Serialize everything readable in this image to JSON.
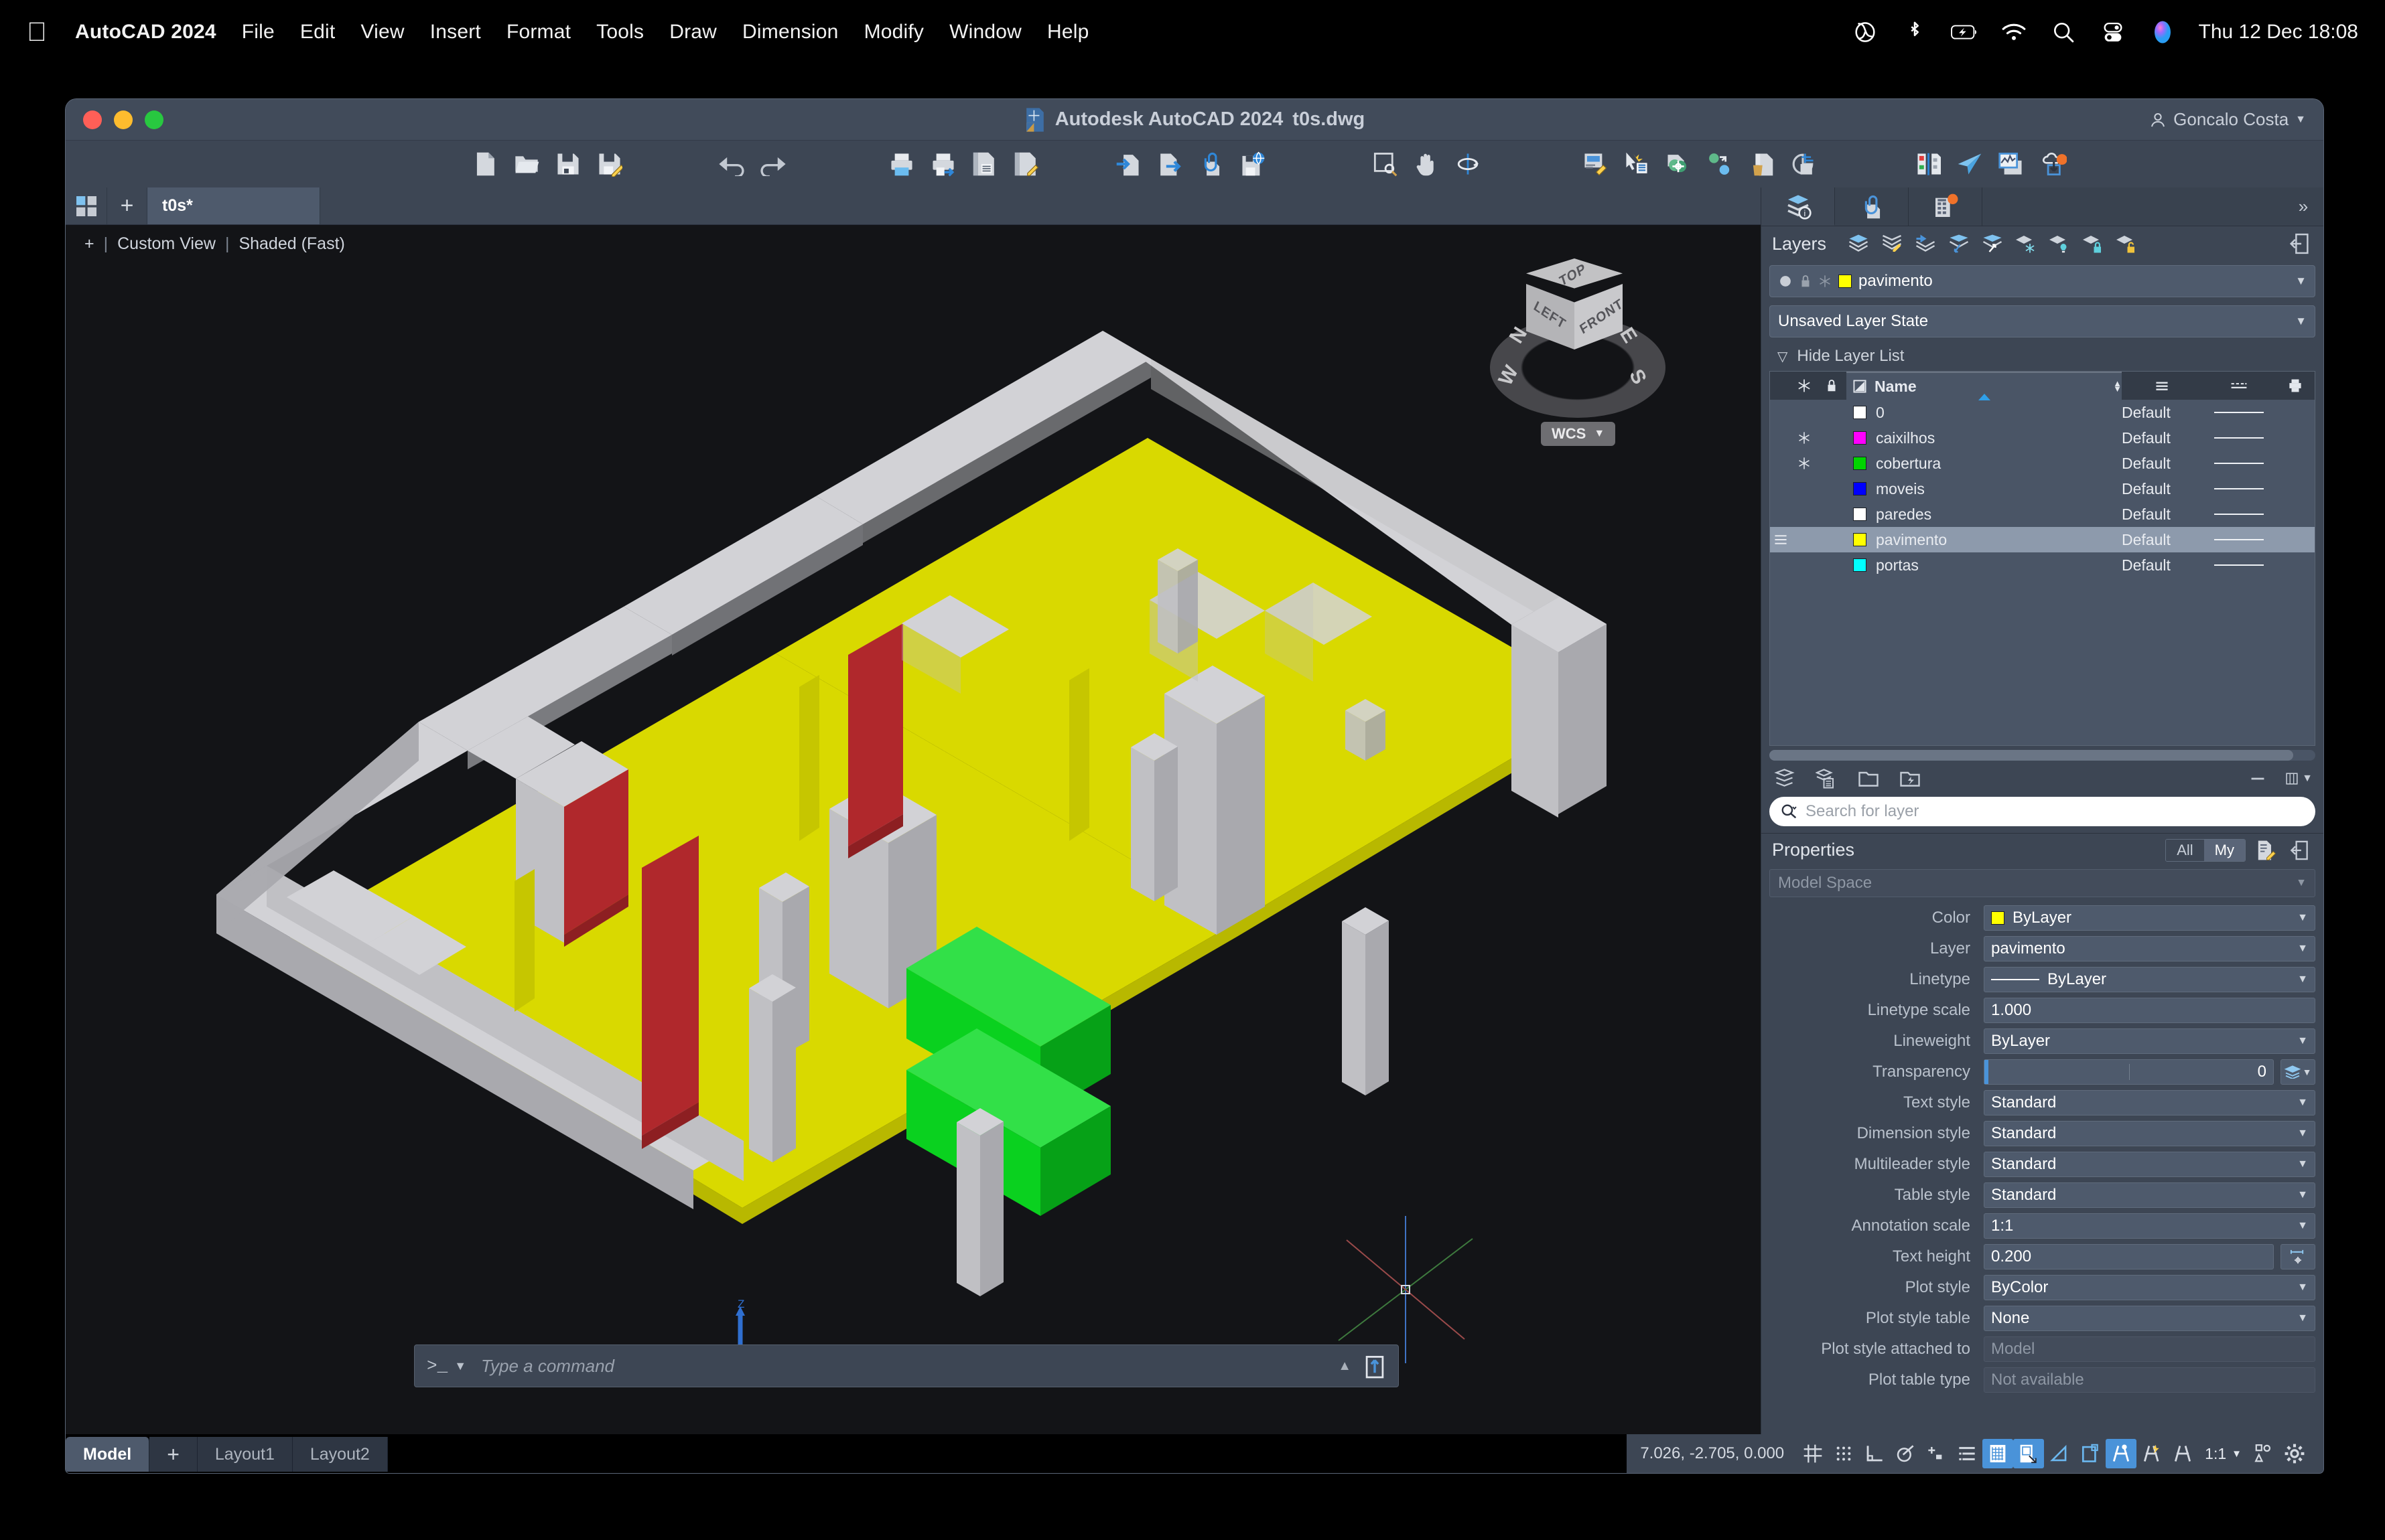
{
  "macos_menubar": {
    "apple_icon": "apple-logo-icon",
    "app_name": "AutoCAD 2024",
    "menus": [
      "File",
      "Edit",
      "View",
      "Insert",
      "Format",
      "Tools",
      "Draw",
      "Dimension",
      "Modify",
      "Window",
      "Help"
    ],
    "status_icons": [
      "creative-cloud-icon",
      "bluetooth-icon",
      "battery-charging-icon",
      "wifi-icon",
      "spotlight-search-icon",
      "control-center-icon",
      "siri-icon"
    ],
    "clock": "Thu 12 Dec  18:08"
  },
  "window": {
    "title": "Autodesk AutoCAD 2024",
    "document": "t0s.dwg",
    "user": "Goncalo Costa",
    "traffic_lights": [
      "close",
      "minimize",
      "zoom"
    ]
  },
  "toolbar": {
    "groups": [
      {
        "name": "file",
        "items": [
          "new-drawing-icon",
          "open-drawing-icon",
          "save-icon",
          "save-as-icon"
        ]
      },
      {
        "name": "history",
        "items": [
          "undo-icon",
          "redo-icon"
        ]
      },
      {
        "name": "plot",
        "items": [
          "plot-icon",
          "plot-preview-icon",
          "page-setup-icon",
          "batch-plot-icon"
        ]
      },
      {
        "name": "exchange",
        "items": [
          "import-icon",
          "export-icon",
          "attach-icon",
          "etransmit-icon"
        ]
      },
      {
        "name": "view",
        "items": [
          "zoom-window-icon",
          "pan-icon",
          "orbit-icon"
        ]
      },
      {
        "name": "tools",
        "items": [
          "properties-icon",
          "quick-select-icon",
          "match-properties-icon",
          "layer-state-icon",
          "purge-icon",
          "measure-icon"
        ]
      },
      {
        "name": "collab",
        "items": [
          "compare-drawings-icon",
          "share-icon",
          "sheet-set-icon",
          "cloud-sync-icon"
        ]
      }
    ]
  },
  "document_tabs": {
    "grid_icon": "drawing-grid-icon",
    "new_tab_icon": "plus-icon",
    "tabs": [
      {
        "label": "t0s*",
        "active": true
      }
    ]
  },
  "viewport": {
    "plus_icon": "viewport-controls-icon",
    "view_label": "Custom View",
    "visual_style": "Shaded (Fast)",
    "viewcube": {
      "top_face": "TOP",
      "left_face": "LEFT",
      "front_face": "FRONT",
      "compass": [
        "N",
        "E",
        "S",
        "W"
      ],
      "coord_system_label": "WCS"
    },
    "ucs_axes": [
      "X",
      "Y",
      "Z"
    ],
    "model_description": "3D shaded apartment floor plan model with grey walls, yellow floor slab, red door panels, green furniture blocks and grey columns"
  },
  "command_line": {
    "prompt": ">_",
    "placeholder": "Type a command",
    "history_icon": "chevron-up-icon",
    "dock_icon": "command-dock-icon"
  },
  "layout_tabs": {
    "tabs": [
      {
        "label": "Model",
        "active": true
      },
      {
        "label": "+",
        "active": false,
        "is_add": true
      },
      {
        "label": "Layout1",
        "active": false
      },
      {
        "label": "Layout2",
        "active": false
      }
    ]
  },
  "status_bar": {
    "coordinates": "7.026,  -2.705, 0.000",
    "icons": [
      {
        "name": "grid-display-icon",
        "on": false
      },
      {
        "name": "snap-mode-icon",
        "on": false
      },
      {
        "name": "ortho-mode-icon",
        "on": false
      },
      {
        "name": "polar-tracking-icon",
        "on": false
      },
      {
        "name": "object-snap-tracking-icon",
        "on": false
      },
      {
        "name": "dynamic-ucs-icon",
        "on": false
      },
      {
        "name": "isometric-drafting-icon",
        "on": true
      },
      {
        "name": "object-snap-icon",
        "on": true
      },
      {
        "name": "show-annotation-objects-icon",
        "on": false
      },
      {
        "name": "lineweight-icon",
        "on": false
      },
      {
        "name": "annotation-visibility-icon",
        "on": true
      },
      {
        "name": "autoscale-icon",
        "on": false
      },
      {
        "name": "annotation-scale-person-icon",
        "on": false
      }
    ],
    "annotation_scale": "1:1",
    "workspace_icon": "workspace-switching-icon",
    "customization_icon": "customization-gear-icon"
  },
  "palette": {
    "tabs": [
      {
        "name": "layers-tab",
        "icon": "layers-info-icon",
        "active": true,
        "badge": null
      },
      {
        "name": "reference-tab",
        "icon": "external-reference-icon",
        "active": false,
        "badge": null
      },
      {
        "name": "blocks-tab",
        "icon": "blocks-palette-icon",
        "active": false,
        "badge": "notification"
      }
    ],
    "collapse_icon": "chevron-double-right-icon"
  },
  "layers_panel": {
    "title": "Layers",
    "toolbar_icons": [
      "layer-properties-icon",
      "layer-edit-icon",
      "layer-previous-icon",
      "layer-make-current-icon",
      "layer-match-icon",
      "layer-freeze-icon",
      "layer-off-icon",
      "layer-lock-icon",
      "layer-unlock-icon"
    ],
    "undock_icon": "undock-palette-icon",
    "current_layer": {
      "on_icon": "lightbulb-on-icon",
      "lock_icon": "unlocked-icon",
      "freeze_icon": "thaw-icon",
      "color": "#ffff00",
      "name": "pavimento"
    },
    "layer_state": "Unsaved Layer State",
    "hide_layer_list_label": "Hide Layer List",
    "columns": [
      "freeze",
      "lock",
      "Name",
      "plot-style",
      "linetype",
      "plot"
    ],
    "name_column_label": "Name",
    "rows": [
      {
        "name": "0",
        "color": "#ffffff",
        "frozen": false,
        "lineweight": "Default",
        "selected": false
      },
      {
        "name": "caixilhos",
        "color": "#ff00ff",
        "frozen": true,
        "lineweight": "Default",
        "selected": false
      },
      {
        "name": "cobertura",
        "color": "#00d400",
        "frozen": true,
        "lineweight": "Default",
        "selected": false
      },
      {
        "name": "moveis",
        "color": "#0000ff",
        "frozen": false,
        "lineweight": "Default",
        "selected": false
      },
      {
        "name": "paredes",
        "color": "#ffffff",
        "frozen": false,
        "lineweight": "Default",
        "selected": false
      },
      {
        "name": "pavimento",
        "color": "#ffff00",
        "frozen": false,
        "lineweight": "Default",
        "selected": true
      },
      {
        "name": "portas",
        "color": "#00ffff",
        "frozen": false,
        "lineweight": "Default",
        "selected": false
      }
    ],
    "bottom_icons": [
      "new-layer-icon",
      "new-layer-filter-icon",
      "layer-group-icon",
      "layer-group-filter-icon"
    ],
    "minimize_icon": "minimize-icon",
    "columns_icon": "columns-options-icon",
    "search": {
      "icon": "search-icon",
      "placeholder": "Search for layer",
      "value": ""
    }
  },
  "properties_panel": {
    "title": "Properties",
    "filter_all": "All",
    "filter_my": "My",
    "filter_active": "My",
    "quick_properties_icon": "quick-properties-icon",
    "undock_icon": "undock-palette-icon",
    "space": "Model Space",
    "rows": [
      {
        "label": "Color",
        "value": "ByLayer",
        "type": "color-combo",
        "swatch": "#ffff00"
      },
      {
        "label": "Layer",
        "value": "pavimento",
        "type": "combo"
      },
      {
        "label": "Linetype",
        "value": "ByLayer",
        "type": "linetype-combo"
      },
      {
        "label": "Linetype scale",
        "value": "1.000",
        "type": "text"
      },
      {
        "label": "Lineweight",
        "value": "ByLayer",
        "type": "combo"
      },
      {
        "label": "Transparency",
        "value": "0",
        "type": "slider",
        "addon": "transparency-bylayer-icon"
      },
      {
        "label": "Text style",
        "value": "Standard",
        "type": "combo"
      },
      {
        "label": "Dimension style",
        "value": "Standard",
        "type": "combo"
      },
      {
        "label": "Multileader style",
        "value": "Standard",
        "type": "combo"
      },
      {
        "label": "Table style",
        "value": "Standard",
        "type": "combo"
      },
      {
        "label": "Annotation scale",
        "value": "1:1",
        "type": "combo"
      },
      {
        "label": "Text height",
        "value": "0.200",
        "type": "text",
        "addon": "pick-height-icon"
      },
      {
        "label": "Plot style",
        "value": "ByColor",
        "type": "combo"
      },
      {
        "label": "Plot style table",
        "value": "None",
        "type": "combo"
      },
      {
        "label": "Plot style attached to",
        "value": "Model",
        "type": "readonly"
      },
      {
        "label": "Plot table type",
        "value": "Not available",
        "type": "readonly"
      }
    ]
  },
  "colors": {
    "window_bg": "#3d4654",
    "panel_bg": "#3d4654",
    "field_bg": "#4e5a6c",
    "viewport_bg": "#131417",
    "accent_blue": "#4a93d9",
    "selection": "#8d9aac",
    "floor_yellow": "#d9d900",
    "door_red": "#b22222",
    "furniture_green": "#00cc22",
    "wall_grey": "#c9c9cc"
  }
}
